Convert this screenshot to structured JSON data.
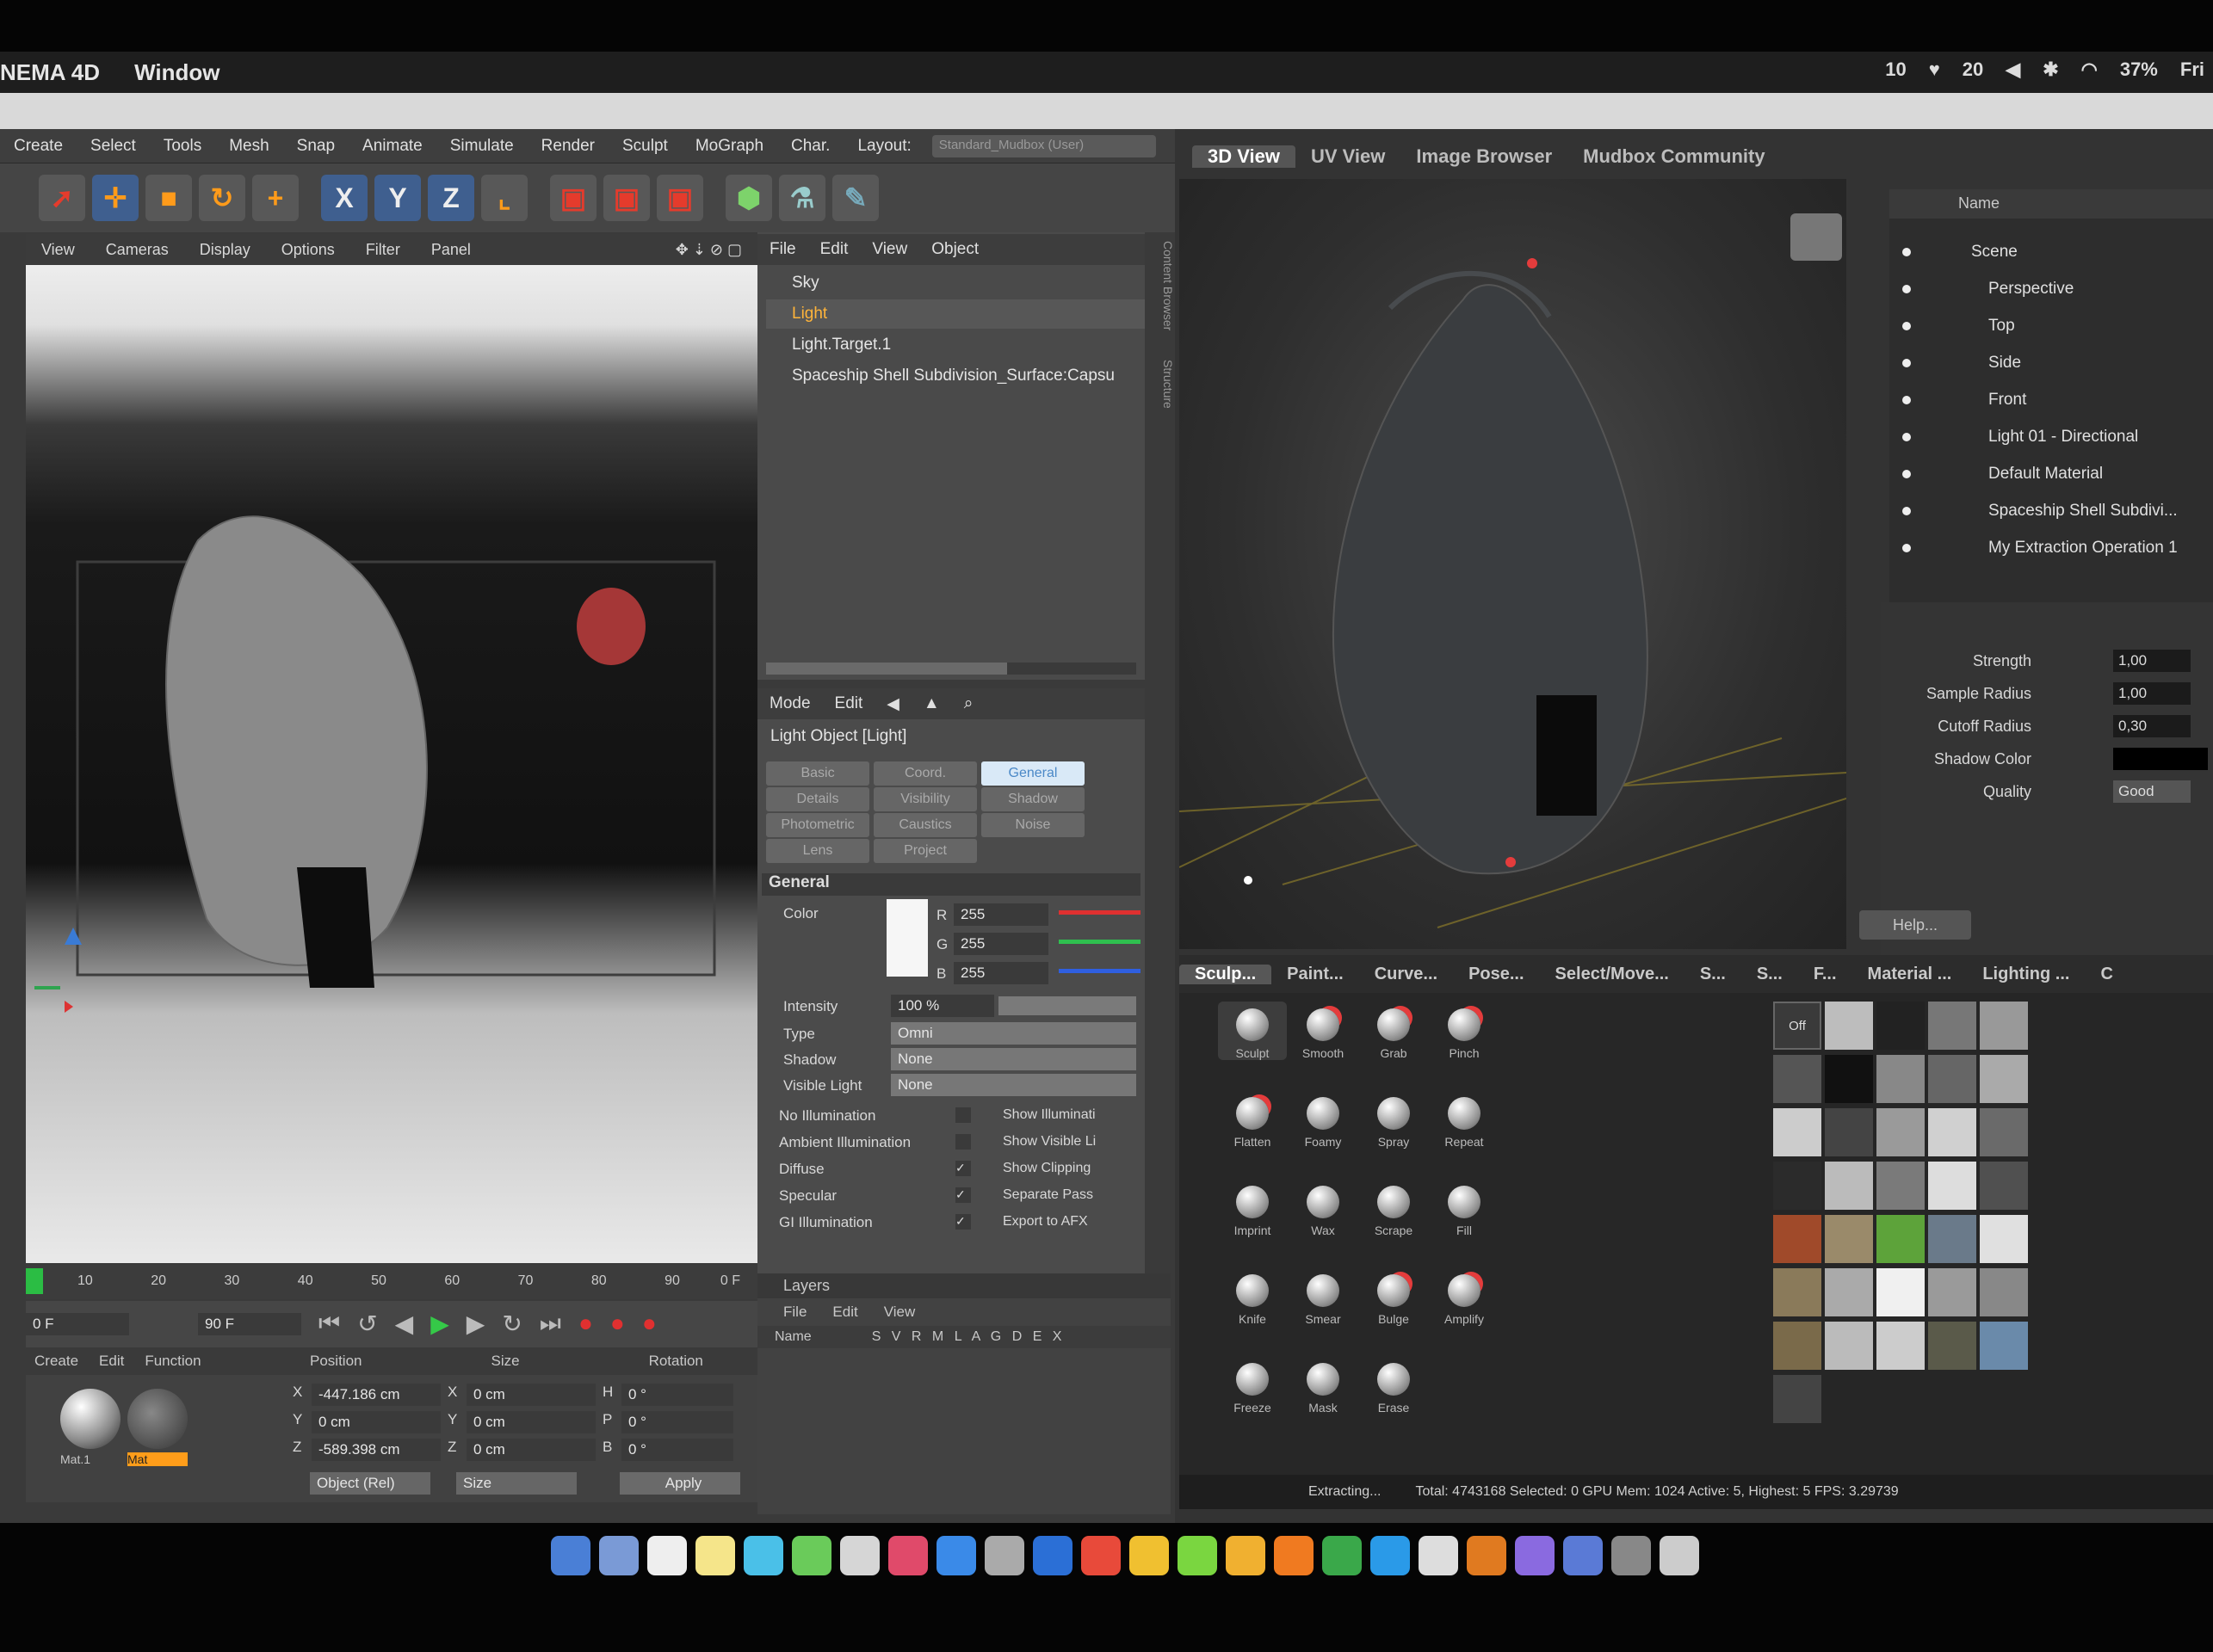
{
  "menubar": {
    "app": "NEMA 4D",
    "window": "Window",
    "status_num": "10",
    "status_num2": "20",
    "battery": "37%",
    "clock": "Fri"
  },
  "c4d": {
    "menu": [
      "Create",
      "Select",
      "Tools",
      "Mesh",
      "Snap",
      "Animate",
      "Simulate",
      "Render",
      "Sculpt",
      "MoGraph",
      "Char.",
      "Layout:"
    ],
    "layout_value": "Standard_Mudbox (User)",
    "toolbar": {
      "x": "X",
      "y": "Y",
      "z": "Z"
    },
    "viewport_menu": [
      "View",
      "Cameras",
      "Display",
      "Options",
      "Filter",
      "Panel"
    ],
    "objmgr": {
      "menu": [
        "File",
        "Edit",
        "View",
        "Object"
      ],
      "items": [
        "Sky",
        "Light",
        "Light.Target.1",
        "Spaceship Shell Subdivision_Surface:Capsu"
      ]
    },
    "attr": {
      "menu": [
        "Mode",
        "Edit"
      ],
      "title": "Light Object [Light]",
      "tabs": [
        "Basic",
        "Coord.",
        "General",
        "Details",
        "Visibility",
        "Shadow",
        "Photometric",
        "Caustics",
        "Noise",
        "Lens",
        "Project"
      ],
      "section": "General",
      "color_label": "Color",
      "r": "255",
      "g": "255",
      "b": "255",
      "r_label": "R",
      "g_label": "G",
      "b_label": "B",
      "intensity_label": "Intensity",
      "intensity": "100 %",
      "type_label": "Type",
      "type": "Omni",
      "shadow_label": "Shadow",
      "shadow": "None",
      "visible_label": "Visible Light",
      "visible": "None",
      "checks_left": [
        "No Illumination",
        "Ambient Illumination",
        "Diffuse",
        "Specular",
        "GI Illumination"
      ],
      "checks_right": [
        "Show Illuminati",
        "Show Visible Li",
        "Show Clipping",
        "Separate Pass",
        "Export to AFX"
      ]
    },
    "timeline": {
      "ticks": [
        "10",
        "20",
        "30",
        "40",
        "50",
        "60",
        "70",
        "80",
        "90"
      ],
      "frame_end": "0 F",
      "start": "0 F",
      "end": "90 F"
    },
    "materials": {
      "menu": [
        "Create",
        "Edit",
        "Function"
      ],
      "items": [
        "Mat.1",
        "Mat"
      ]
    },
    "coords": {
      "headers": [
        "Position",
        "Size",
        "Rotation"
      ],
      "rows": [
        [
          "X",
          "-447.186 cm",
          "X",
          "0 cm",
          "H",
          "0 °"
        ],
        [
          "Y",
          "0 cm",
          "Y",
          "0 cm",
          "P",
          "0 °"
        ],
        [
          "Z",
          "-589.398 cm",
          "Z",
          "0 cm",
          "B",
          "0 °"
        ]
      ],
      "mode": "Object (Rel)",
      "size_mode": "Size",
      "apply": "Apply"
    },
    "layers": {
      "title": "Layers",
      "menu": [
        "File",
        "Edit",
        "View"
      ],
      "name_col": "Name",
      "flags": "S V R M L A G D E X"
    },
    "side_tabs": [
      "Content Browser",
      "Structure"
    ]
  },
  "mudbox": {
    "tabs": [
      "3D View",
      "UV View",
      "Image Browser",
      "Mudbox Community"
    ],
    "outliner": {
      "header": "Name",
      "items": [
        "Scene",
        "Perspective",
        "Top",
        "Side",
        "Front",
        "Light 01 - Directional",
        "Default Material",
        "Spaceship Shell Subdivi...",
        "My Extraction Operation 1"
      ]
    },
    "props": [
      {
        "label": "Strength",
        "value": "1,00"
      },
      {
        "label": "Sample Radius",
        "value": "1,00"
      },
      {
        "label": "Cutoff Radius",
        "value": "0,30"
      },
      {
        "label": "Shadow Color",
        "value": ""
      },
      {
        "label": "Quality",
        "value": "Good"
      }
    ],
    "help": "Help...",
    "trays": [
      "Sculp...",
      "Paint...",
      "Curve...",
      "Pose...",
      "Select/Move...",
      "S...",
      "S...",
      "F...",
      "Material ...",
      "Lighting ...",
      "C"
    ],
    "tools": [
      "Sculpt",
      "Smooth",
      "Grab",
      "Pinch",
      "Flatten",
      "Foamy",
      "Spray",
      "Repeat",
      "Imprint",
      "Wax",
      "Scrape",
      "Fill",
      "Knife",
      "Smear",
      "Bulge",
      "Amplify",
      "Freeze",
      "Mask",
      "Erase"
    ],
    "stamp_off": "Off",
    "status": "Total: 4743168   Selected: 0   GPU Mem: 1024   Active: 5, Highest: 5   FPS: 3.29739",
    "extracting": "Extracting..."
  },
  "colors": {
    "accent": "#4a88c7",
    "selected": "#ffb43a",
    "bg": "#3a3a3a"
  }
}
